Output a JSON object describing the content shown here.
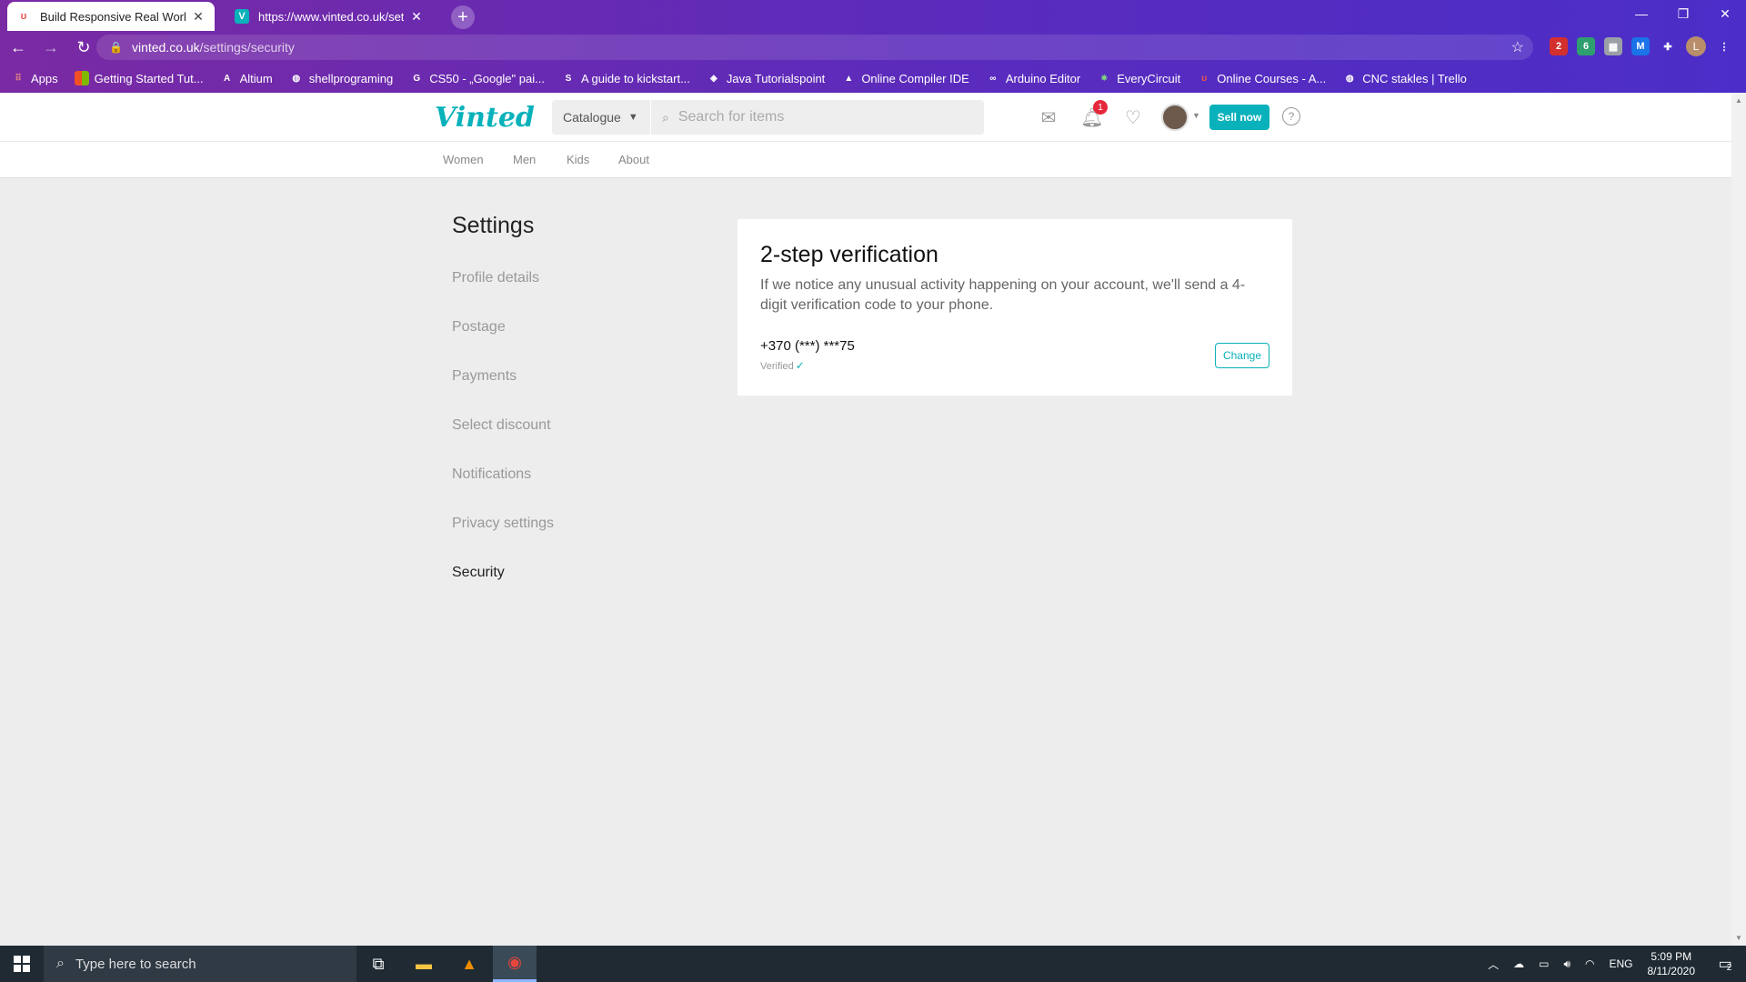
{
  "browser": {
    "tabs": [
      {
        "title": "Build Responsive Real World Wel",
        "active": true
      },
      {
        "title": "https://www.vinted.co.uk/setting",
        "active": false
      }
    ],
    "url_host": "vinted.co.uk",
    "url_path": "/settings/security",
    "bookmarks": [
      {
        "label": "Apps",
        "icon": "apps-grid-icon"
      },
      {
        "label": "Getting Started Tut...",
        "icon": "microsoft-icon"
      },
      {
        "label": "Altium",
        "icon": "altium-icon"
      },
      {
        "label": "shellprograming",
        "icon": "globe-icon"
      },
      {
        "label": "CS50 - „Google\" pai...",
        "icon": "google-icon"
      },
      {
        "label": "A guide to kickstart...",
        "icon": "guide-icon"
      },
      {
        "label": "Java  Tutorialspoint",
        "icon": "tutorialspoint-icon"
      },
      {
        "label": "Online Compiler IDE",
        "icon": "compiler-icon"
      },
      {
        "label": "Arduino Editor",
        "icon": "arduino-icon"
      },
      {
        "label": "EveryCircuit",
        "icon": "everycircuit-icon"
      },
      {
        "label": "Online Courses - A...",
        "icon": "udemy-icon"
      },
      {
        "label": "CNC stakles | Trello",
        "icon": "globe-icon"
      }
    ],
    "ext_badges": [
      "2",
      "6"
    ],
    "profile_initial": "L"
  },
  "site": {
    "logo": "Vinted",
    "catalogue_label": "Catalogue",
    "search_placeholder": "Search for items",
    "notification_count": "1",
    "sell_label": "Sell now",
    "help_label": "?",
    "nav": [
      "Women",
      "Men",
      "Kids",
      "About"
    ]
  },
  "settings": {
    "title": "Settings",
    "items": [
      "Profile details",
      "Postage",
      "Payments",
      "Select discount",
      "Notifications",
      "Privacy settings",
      "Security"
    ],
    "active_item": "Security"
  },
  "two_step": {
    "title": "2-step verification",
    "description": "If we notice any unusual activity happening on your account, we'll send a 4-digit verification code to your phone.",
    "phone": "+370 (***) ***75",
    "status": "Verified",
    "change_label": "Change"
  },
  "taskbar": {
    "search_placeholder": "Type here to search",
    "language": "ENG",
    "time": "5:09 PM",
    "date": "8/11/2020",
    "action_center_count": "2"
  },
  "colors": {
    "brand": "#09b1ba",
    "badge": "#e5283c",
    "chrome_start": "#7a2aa3",
    "chrome_end": "#4b2ec8"
  }
}
